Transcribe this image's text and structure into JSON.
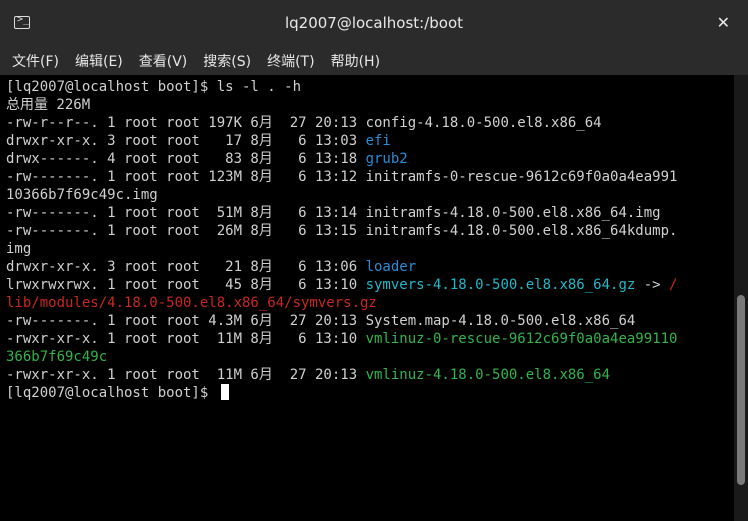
{
  "window": {
    "title": "lq2007@localhost:/boot",
    "close_glyph": "✕",
    "icon": "terminal-icon"
  },
  "menu": {
    "items": [
      "文件(F)",
      "编辑(E)",
      "查看(V)",
      "搜索(S)",
      "终端(T)",
      "帮助(H)"
    ]
  },
  "terminal": {
    "prompt": "[lq2007@localhost boot]$ ",
    "command": "ls -l . -h",
    "total": "总用量 226M",
    "rows": [
      {
        "meta": "-rw-r--r--. 1 root root 197K 6月  27 20:13 ",
        "name": "config-4.18.0-500.el8.x86_64"
      },
      {
        "meta": "drwxr-xr-x. 3 root root   17 8月   6 13:03 ",
        "name": "efi"
      },
      {
        "meta": "drwx------. 4 root root   83 8月   6 13:18 ",
        "name": "grub2"
      },
      {
        "meta": "-rw-------. 1 root root 123M 8月   6 13:12 ",
        "name": "initramfs-0-rescue-9612c69f0a0a4ea991",
        "cont": "10366b7f69c49c.img"
      },
      {
        "meta": "-rw-------. 1 root root  51M 8月   6 13:14 ",
        "name": "initramfs-4.18.0-500.el8.x86_64.img"
      },
      {
        "meta": "-rw-------. 1 root root  26M 8月   6 13:15 ",
        "name": "initramfs-4.18.0-500.el8.x86_64kdump.",
        "cont": "img"
      },
      {
        "meta": "drwxr-xr-x. 3 root root   21 8月   6 13:06 ",
        "name": "loader"
      },
      {
        "meta": "lrwxrwxrwx. 1 root root   45 8月   6 13:10 ",
        "name": "symvers-4.18.0-500.el8.x86_64.gz",
        "arrow": " -> ",
        "target_a": "/",
        "target_b": "lib/modules/4.18.0-500.el8.x86_64/symvers.gz"
      },
      {
        "meta": "-rw-------. 1 root root 4.3M 6月  27 20:13 ",
        "name": "System.map-4.18.0-500.el8.x86_64"
      },
      {
        "meta": "-rwxr-xr-x. 1 root root  11M 8月   6 13:10 ",
        "name": "vmlinuz-0-rescue-9612c69f0a0a4ea99110",
        "cont": "366b7f69c49c"
      },
      {
        "meta": "-rwxr-xr-x. 1 root root  11M 6月  27 20:13 ",
        "name": "vmlinuz-4.18.0-500.el8.x86_64"
      }
    ]
  },
  "colors": {
    "directory": "#2a8cd6",
    "symlink": "#22b8c8",
    "link_target": "#c8281e",
    "executable": "#33b44a"
  }
}
